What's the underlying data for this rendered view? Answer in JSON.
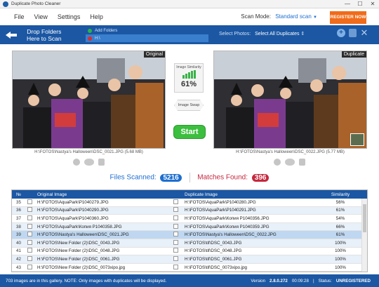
{
  "window": {
    "title": "Duplicate Photo Cleaner",
    "min": "—",
    "max": "☐",
    "close": "✕"
  },
  "menu": [
    "File",
    "View",
    "Settings",
    "Help"
  ],
  "scan_mode": {
    "label": "Scan Mode:",
    "value": "Standard scan"
  },
  "register_button": "REGISTER NOW",
  "drop": {
    "line1": "Drop Folders",
    "line2": "Here to Scan"
  },
  "folders": {
    "add_label": "Add Folders",
    "item": "H:\\"
  },
  "select_photos": {
    "label": "Select Photos:",
    "value": "Select All Duplicates"
  },
  "left_panel": {
    "tag": "Original",
    "caption": "H:\\FOTOS\\Nastya's Halloween\\DSC_0021.JPG (5.68 MB)"
  },
  "right_panel": {
    "tag": "Duplicate",
    "caption": "H:\\FOTOS\\Nastya's Halloween\\DSC_0022.JPG (5.77 MB)"
  },
  "similarity": {
    "label": "Image Similarity",
    "value": "61%"
  },
  "swap_label": "Image Swap",
  "start_button": "Start",
  "stats": {
    "scanned_label": "Files Scanned:",
    "scanned": "5216",
    "matches_label": "Matches Found:",
    "matches": "396"
  },
  "table": {
    "headers": {
      "no": "№",
      "original": "Original Image",
      "duplicate": "Duplicate Image",
      "similarity": "Similarity"
    },
    "rows": [
      {
        "no": "35",
        "orig": "H:\\FOTOS\\AquaPark\\P1040279.JPG",
        "dup": "H:\\FOTOS\\AquaPark\\P1040280.JPG",
        "sim": "56%"
      },
      {
        "no": "36",
        "orig": "H:\\FOTOS\\AquaPark\\P1040290.JPG",
        "dup": "H:\\FOTOS\\AquaPark\\P1040291.JPG",
        "sim": "61%"
      },
      {
        "no": "37",
        "orig": "H:\\FOTOS\\AquaPark\\P1040360.JPG",
        "dup": "H:\\FOTOS\\AquaPark\\Копия P1040356.JPG",
        "sim": "54%"
      },
      {
        "no": "38",
        "orig": "H:\\FOTOS\\AquaPark\\Копия P1040358.JPG",
        "dup": "H:\\FOTOS\\AquaPark\\Копия P1040359.JPG",
        "sim": "66%"
      },
      {
        "no": "39",
        "orig": "H:\\FOTOS\\Nastya's Halloween\\DSC_0021.JPG",
        "dup": "H:\\FOTOS\\Nastya's Halloween\\DSC_0022.JPG",
        "sim": "61%"
      },
      {
        "no": "40",
        "orig": "H:\\FOTOS\\New Folder (2)\\DSC_0043.JPG",
        "dup": "H:\\FOTOS\\tif\\DSC_0043.JPG",
        "sim": "100%"
      },
      {
        "no": "41",
        "orig": "H:\\FOTOS\\New Folder (2)\\DSC_0048.JPG",
        "dup": "H:\\FOTOS\\tif\\DSC_0048.JPG",
        "sim": "100%"
      },
      {
        "no": "42",
        "orig": "H:\\FOTOS\\New Folder (2)\\DSC_0061.JPG",
        "dup": "H:\\FOTOS\\tif\\DSC_0061.JPG",
        "sim": "100%"
      },
      {
        "no": "43",
        "orig": "H:\\FOTOS\\New Folder (2)\\DSC_0073xipo.jpg",
        "dup": "H:\\FOTOS\\tif\\DSC_0073xipo.jpg",
        "sim": "100%"
      }
    ]
  },
  "status": {
    "message": "703 images are in this gallery. NOTE: Only images with duplicates will be displayed.",
    "version_label": "Version",
    "version": "2.8.0.272",
    "time": "00:09:28",
    "status_label": "Status:",
    "status_value": "UNREGISTERED"
  }
}
